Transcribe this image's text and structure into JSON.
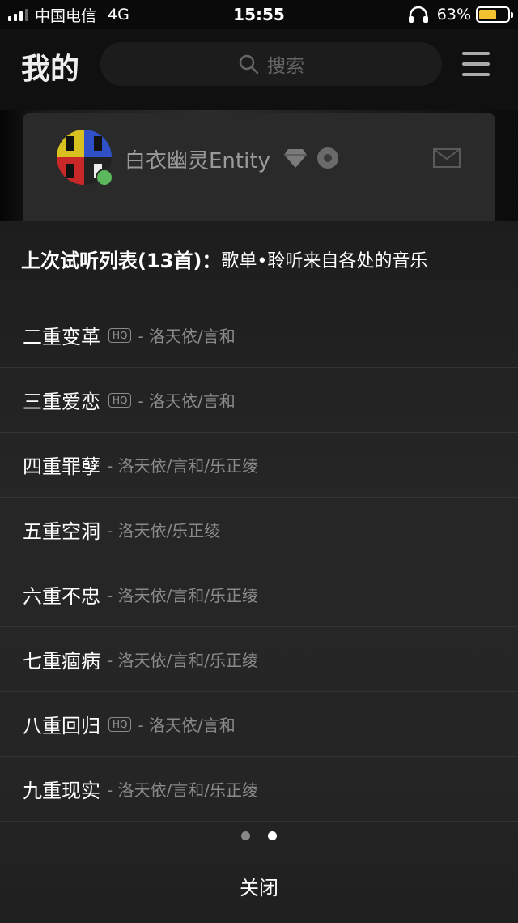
{
  "status_bar": {
    "carrier": "中国电信",
    "network": "4G",
    "time": "15:55",
    "battery_percent": "63%",
    "battery_level": 0.63,
    "battery_color": "#f2c230"
  },
  "header": {
    "title": "我的",
    "search_placeholder": "搜索",
    "search_icon": "search-icon",
    "menu_icon": "menu-icon"
  },
  "profile": {
    "username": "白衣幽灵Entity",
    "badges": [
      "diamond-icon",
      "music-badge-icon"
    ],
    "mail_icon": "mail-icon",
    "login_badge_color": "#5cb85c"
  },
  "sheet": {
    "title": "上次试听列表(13首)：",
    "subtitle": "歌单•聆听来自各处的音乐",
    "hq_label": "HQ",
    "songs": [
      {
        "title": "二重变革",
        "hq": true,
        "artist": "- 洛天依/言和"
      },
      {
        "title": "三重爱恋",
        "hq": true,
        "artist": "- 洛天依/言和"
      },
      {
        "title": "四重罪孽",
        "hq": false,
        "artist": "- 洛天依/言和/乐正绫"
      },
      {
        "title": "五重空洞",
        "hq": false,
        "artist": "- 洛天依/乐正绫"
      },
      {
        "title": "六重不忠",
        "hq": false,
        "artist": "- 洛天依/言和/乐正绫"
      },
      {
        "title": "七重痼病",
        "hq": false,
        "artist": "- 洛天依/言和/乐正绫"
      },
      {
        "title": "八重回归",
        "hq": true,
        "artist": "- 洛天依/言和"
      },
      {
        "title": "九重现实",
        "hq": false,
        "artist": "- 洛天依/言和/乐正绫"
      }
    ],
    "pagination": {
      "total": 2,
      "current": 2
    },
    "close_label": "关闭"
  }
}
